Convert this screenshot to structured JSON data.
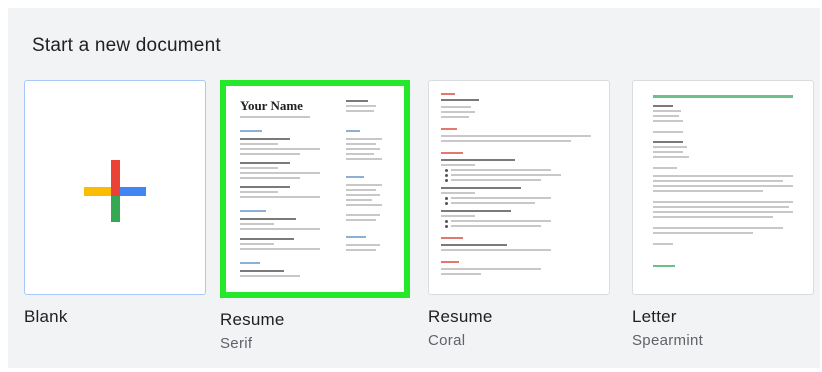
{
  "gallery": {
    "heading": "Start a new document",
    "templates": [
      {
        "name": "Blank",
        "subtitle": "",
        "selected": false
      },
      {
        "name": "Resume",
        "subtitle": "Serif",
        "selected": true,
        "preview_heading": "Your Name"
      },
      {
        "name": "Resume",
        "subtitle": "Coral",
        "selected": false
      },
      {
        "name": "Letter",
        "subtitle": "Spearmint",
        "selected": false
      }
    ]
  },
  "colors": {
    "background": "#f1f3f4",
    "selection_outline": "#26e82a",
    "plus_red": "#ea4335",
    "plus_blue": "#4285f4",
    "plus_green": "#34a853",
    "plus_yellow": "#fbbc04"
  }
}
